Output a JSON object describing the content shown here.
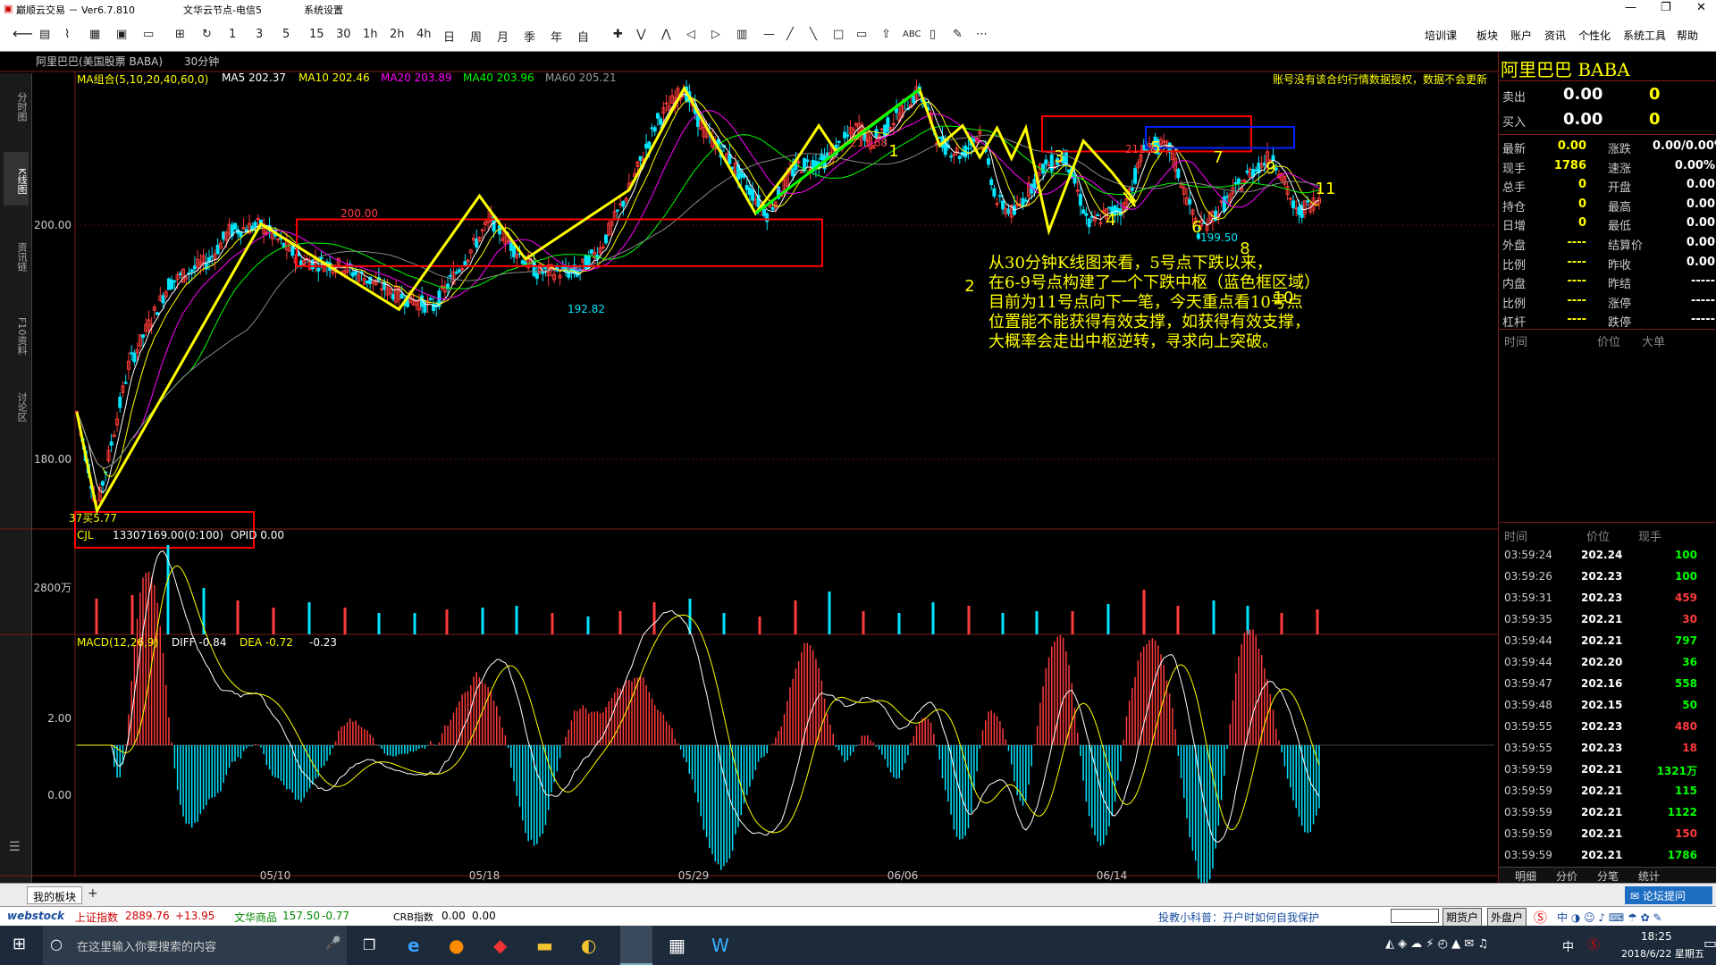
{
  "window": {
    "title": "巅顺云交易 － Ver6.7.810",
    "server": "文华云节点-电信5",
    "sys": "系统设置"
  },
  "toolbar": {
    "periods": [
      "1",
      "3",
      "5",
      "15",
      "30",
      "1h",
      "2h",
      "4h",
      "日",
      "周",
      "月",
      "季",
      "年",
      "自"
    ],
    "menu": [
      "培训课",
      "板块",
      "账户",
      "资讯",
      "个性化",
      "系统工具",
      "帮助"
    ]
  },
  "left_tabs": [
    "分时图",
    "K线图",
    "资讯链",
    "F10资料",
    "讨论区"
  ],
  "chart_header": {
    "symbol": "阿里巴巴(美国股票 BABA)",
    "period": "30分钟",
    "ma_group": "MA组合(5,10,20,40,60,0)",
    "ma5": "MA5 202.37",
    "ma10": "MA10 202.46",
    "ma20": "MA20 203.89",
    "ma40": "MA40 203.96",
    "ma60": "MA60 205.21",
    "notice": "账号没有该合约行情数据授权，数据不会更新"
  },
  "price_axis": [
    "200.00",
    "180.00"
  ],
  "price_labels": {
    "high1": "211.68",
    "high2": "211.5",
    "p200": "200.00",
    "low1": "192.82",
    "low2": "199.50",
    "low0": "37买5.77"
  },
  "wave_labels": [
    "1",
    "2",
    "3",
    "4",
    "5",
    "6",
    "7",
    "8",
    "9",
    "10",
    "11"
  ],
  "volume_header": {
    "name": "CJL",
    "value": "13307169.00(0:100)",
    "opid": "OPID 0.00"
  },
  "volume_axis": "2800万",
  "macd_header": {
    "name": "MACD(12,26,9)",
    "diff": "DIFF -0.84",
    "dea": "DEA -0.72",
    "macd": "-0.23"
  },
  "macd_axis": [
    "2.00",
    "0.00"
  ],
  "date_axis": [
    "05/10",
    "05/18",
    "05/29",
    "06/06",
    "06/14"
  ],
  "annotation": [
    "从30分钟K线图来看，5号点下跌以来，",
    "在6-9号点构建了一个下跌中枢（蓝色框区域）",
    "目前为11号点向下一笔，今天重点看10号点",
    "位置能不能获得有效支撑，如获得有效支撑，",
    "大概率会走出中枢逆转，寻求向上突破。"
  ],
  "quote": {
    "name": "阿里巴巴 BABA",
    "sell": {
      "label": "卖出",
      "price": "0.00",
      "vol": "0"
    },
    "buy": {
      "label": "买入",
      "price": "0.00",
      "vol": "0"
    },
    "fields": [
      [
        "最新",
        "0.00",
        "涨跌",
        "0.00/0.00%"
      ],
      [
        "现手",
        "1786",
        "速涨",
        "0.00%"
      ],
      [
        "总手",
        "0",
        "开盘",
        "0.00"
      ],
      [
        "持仓",
        "0",
        "最高",
        "0.00"
      ],
      [
        "日增",
        "0",
        "最低",
        "0.00"
      ],
      [
        "外盘",
        "----",
        "结算价",
        "0.00"
      ],
      [
        "比例",
        "----",
        "昨收",
        "0.00"
      ],
      [
        "内盘",
        "----",
        "昨结",
        "-----"
      ],
      [
        "比例",
        "----",
        "涨停",
        "-----"
      ],
      [
        "杠杆",
        "----",
        "跌停",
        "-----"
      ]
    ],
    "trade_head1": [
      "时间",
      "价位",
      "大单"
    ],
    "trade_head2": [
      "时间",
      "价位",
      "现手"
    ],
    "ticks": [
      [
        "03:59:24",
        "202.24",
        "100",
        "g"
      ],
      [
        "03:59:26",
        "202.23",
        "100",
        "g"
      ],
      [
        "03:59:31",
        "202.23",
        "459",
        "r"
      ],
      [
        "03:59:35",
        "202.21",
        "30",
        "r"
      ],
      [
        "03:59:44",
        "202.21",
        "797",
        "g"
      ],
      [
        "03:59:44",
        "202.20",
        "36",
        "g"
      ],
      [
        "03:59:47",
        "202.16",
        "558",
        "g"
      ],
      [
        "03:59:48",
        "202.15",
        "50",
        "g"
      ],
      [
        "03:59:55",
        "202.23",
        "480",
        "r"
      ],
      [
        "03:59:55",
        "202.23",
        "18",
        "r"
      ],
      [
        "03:59:59",
        "202.21",
        "1321万",
        "g"
      ],
      [
        "03:59:59",
        "202.21",
        "115",
        "g"
      ],
      [
        "03:59:59",
        "202.21",
        "1122",
        "g"
      ],
      [
        "03:59:59",
        "202.21",
        "150",
        "r"
      ],
      [
        "03:59:59",
        "202.21",
        "1786",
        "g"
      ]
    ],
    "bottom_tabs": [
      "明细",
      "分价",
      "分笔",
      "统计"
    ],
    "forum": "论坛提问"
  },
  "status": {
    "my_board": "我的板块",
    "add": "+"
  },
  "bottom": {
    "logo": "webstock",
    "sh_label": "上证指数",
    "sh_val": "2889.76",
    "sh_chg": "+13.95",
    "wh_label": "文华商品",
    "wh_val": "157.50",
    "wh_chg": "-0.77",
    "crb_label": "CRB指数",
    "crb_val": "0.00",
    "crb_chg": "0.00",
    "tip": "投教小科普：开户时如何自我保护",
    "btn1": "期货户",
    "btn2": "外盘户"
  },
  "taskbar": {
    "search": "在这里输入你要搜索的内容",
    "time": "18:25",
    "date": "2018/6/22 星期五",
    "ime": "中"
  },
  "colors": {
    "up": "#ff3b3b",
    "down": "#00e5ff",
    "yellow": "#ffff00",
    "ma10": "#ffff00",
    "ma20": "#ff00ff",
    "ma40": "#00ff00",
    "ma60": "#888888"
  }
}
